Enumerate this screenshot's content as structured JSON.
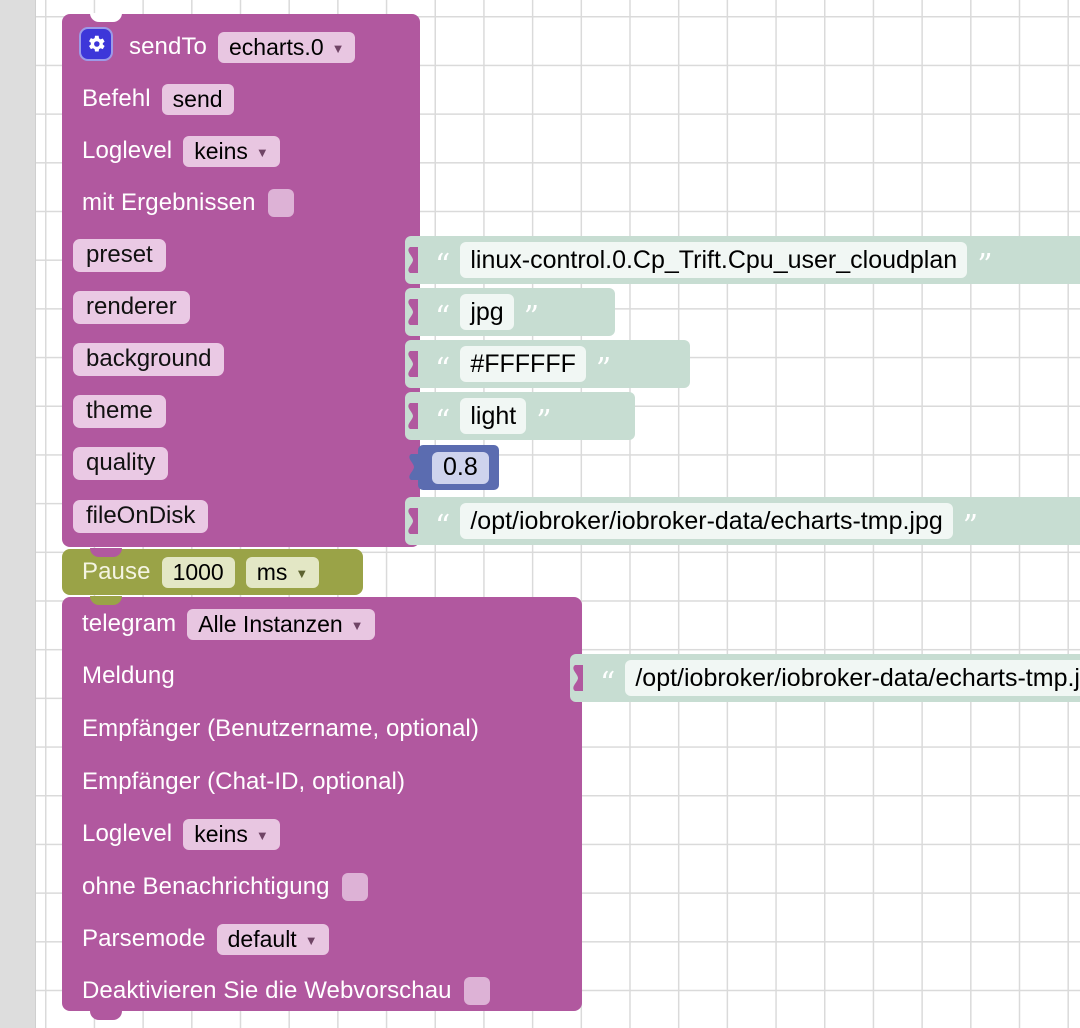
{
  "workspace": {
    "background_color": "#ffffff",
    "gutter_color": "#dddddd",
    "grid_dot_color": "#d4d4d4"
  },
  "blocks": {
    "sendto": {
      "name": "sendTo",
      "color": "#b1589f",
      "mutator_icon": "gear-icon",
      "title_label": "sendTo",
      "instance_value": "echarts.0",
      "rows": [
        {
          "label": "Befehl",
          "field_value": "send",
          "field_type": "text"
        },
        {
          "label": "Loglevel",
          "field_value": "keins",
          "field_type": "dropdown"
        },
        {
          "label": "mit Ergebnissen",
          "field_value": "",
          "field_type": "checkbox"
        }
      ],
      "inputs": [
        {
          "chip": "preset",
          "value": "linux-control.0.Cp_Trift.Cpu_user_cloudplan",
          "value_type": "string"
        },
        {
          "chip": "renderer",
          "value": "jpg",
          "value_type": "string"
        },
        {
          "chip": "background",
          "value": "#FFFFFF",
          "value_type": "string"
        },
        {
          "chip": "theme",
          "value": "light",
          "value_type": "string"
        },
        {
          "chip": "quality",
          "value": "0.8",
          "value_type": "number"
        },
        {
          "chip": "fileOnDisk",
          "value": "/opt/iobroker/iobroker-data/echarts-tmp.jpg",
          "value_type": "string"
        }
      ]
    },
    "pause": {
      "name": "Pause",
      "color": "#9aa347",
      "label": "Pause",
      "amount": "1000",
      "unit": "ms"
    },
    "telegram": {
      "name": "telegram",
      "color": "#b1589f",
      "title_label": "telegram",
      "instance_value": "Alle Instanzen",
      "rows": [
        {
          "label": "Meldung",
          "field_type": "input",
          "value": "/opt/iobroker/iobroker-data/echarts-tmp.jpg"
        },
        {
          "label": "Empfänger (Benutzername, optional)",
          "field_type": "input",
          "value": ""
        },
        {
          "label": "Empfänger (Chat-ID, optional)",
          "field_type": "input",
          "value": ""
        },
        {
          "label": "Loglevel",
          "field_type": "dropdown",
          "value": "keins"
        },
        {
          "label": "ohne Benachrichtigung",
          "field_type": "checkbox",
          "value": ""
        },
        {
          "label": "Parsemode",
          "field_type": "dropdown",
          "value": "default"
        },
        {
          "label": "Deaktivieren Sie die Webvorschau",
          "field_type": "checkbox",
          "value": ""
        }
      ]
    }
  },
  "colors": {
    "statement_purple": "#b1589f",
    "statement_olive": "#9aa347",
    "value_mint": "#c7ddd2",
    "value_number_blue": "#5b6cb0",
    "field_pink": "#e8c6e1",
    "field_olive": "#e3e7c5",
    "mutator_blue": "#3d36d9"
  }
}
